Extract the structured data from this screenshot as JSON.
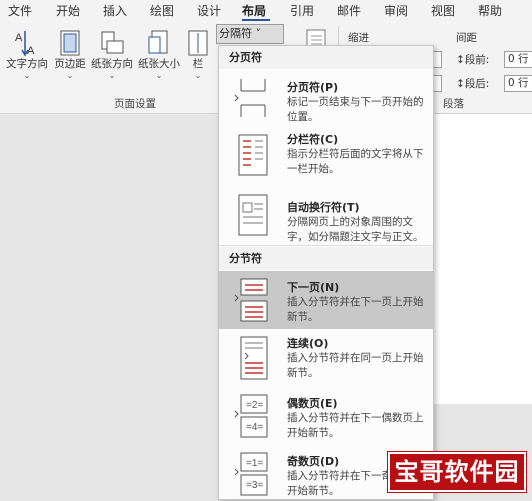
{
  "tabs": [
    "文件",
    "开始",
    "插入",
    "绘图",
    "设计",
    "布局",
    "引用",
    "邮件",
    "审阅",
    "视图",
    "帮助"
  ],
  "active_tab": "布局",
  "ribbon": {
    "buttons": [
      {
        "label": "文字方向",
        "caret": "⌄",
        "icon": "text-direction-icon"
      },
      {
        "label": "页边距",
        "caret": "⌄",
        "icon": "margins-icon"
      },
      {
        "label": "纸张方向",
        "caret": "⌄",
        "icon": "orientation-icon"
      },
      {
        "label": "纸张大小",
        "caret": "⌄",
        "icon": "size-icon"
      },
      {
        "label": "栏",
        "caret": "⌄",
        "icon": "columns-icon"
      }
    ],
    "breaks_button": "分隔符 ˅",
    "page_setup_label": "页面设置",
    "indent_label": "缩进",
    "spacing_label": "间距",
    "spacing_before_label": "段前:",
    "spacing_after_label": "段后:",
    "spacing_before_value": "0 行",
    "spacing_after_value": "0 行",
    "paragraph_label": "段落"
  },
  "dropdown": {
    "page_breaks_header": "分页符",
    "section_breaks_header": "分节符",
    "items": [
      {
        "title": "分页符(P)",
        "desc": "标记一页结束与下一页开始的位置。",
        "icon": "page-break-icon"
      },
      {
        "title": "分栏符(C)",
        "desc": "指示分栏符后面的文字将从下一栏开始。",
        "icon": "column-break-icon"
      },
      {
        "title": "自动换行符(T)",
        "desc": "分隔网页上的对象周围的文字，如分隔题注文字与正文。",
        "icon": "text-wrapping-break-icon"
      },
      {
        "title": "下一页(N)",
        "desc": "插入分节符并在下一页上开始新节。",
        "icon": "next-page-icon"
      },
      {
        "title": "连续(O)",
        "desc": "插入分节符并在同一页上开始新节。",
        "icon": "continuous-icon"
      },
      {
        "title": "偶数页(E)",
        "desc": "插入分节符并在下一偶数页上开始新节。",
        "icon": "even-page-icon"
      },
      {
        "title": "奇数页(D)",
        "desc": "插入分节符并在下一奇数页上开始新节。",
        "icon": "odd-page-icon"
      }
    ]
  },
  "watermark": "宝哥软件园",
  "colors": {
    "accent": "#2b579a",
    "highlight": "#c8c8c8",
    "mark": "#c0392b",
    "watermark": "#b80f14"
  }
}
